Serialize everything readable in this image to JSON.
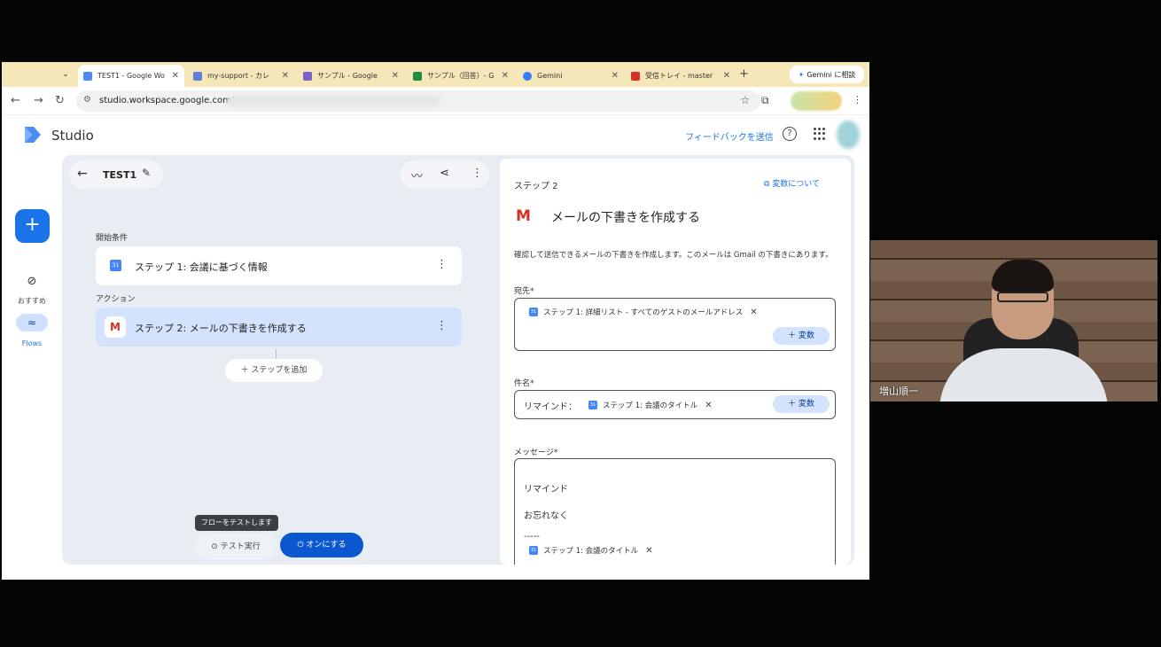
{
  "browser": {
    "tabs": [
      {
        "title": "TEST1 - Google Wo",
        "color": "#4c8bf5",
        "active": true
      },
      {
        "title": "my-support - カレ",
        "color": "#5f7fdb",
        "active": false
      },
      {
        "title": "サンプル - Google",
        "color": "#7b61c9",
        "active": false
      },
      {
        "title": "サンプル（回答）- G",
        "color": "#1e8e3e",
        "active": false
      },
      {
        "title": "Gemini",
        "color": "#3a7bf7",
        "active": false
      },
      {
        "title": "受信トレイ - master",
        "color": "#d93025",
        "active": false
      }
    ],
    "gemini_button": "Gemini に相談",
    "url": "studio.workspace.google.com/"
  },
  "studio": {
    "app_name": "Studio",
    "feedback": "フィードバックを送信"
  },
  "rail": {
    "recommend_label": "おすすめ",
    "flows_label": "Flows"
  },
  "flow": {
    "name": "TEST1",
    "trigger_label": "開始条件",
    "action_label": "アクション",
    "step1": "ステップ 1: 会議に基づく情報",
    "step2": "ステップ 2: メールの下書きを作成する",
    "add_step": "＋ ステップを追加",
    "tooltip": "フローをテストします",
    "test_run": "⊙ テスト実行",
    "turn_on": "⏻ オンにする"
  },
  "panel": {
    "step": "ステップ 2",
    "about_vars": "変数について",
    "title": "メールの下書きを作成する",
    "description": "確認して送信できるメールの下書きを作成します。このメールは Gmail の下書きにあります。",
    "to_label": "宛先*",
    "to_chip": "ステップ 1: 詳細リスト - すべてのゲストのメールアドレス",
    "var_button": "＋ 変数",
    "subject_label": "件名*",
    "subject_prefix": "リマインド：",
    "subject_chip": "ステップ 1: 会議のタイトル",
    "message_label": "メッセージ*",
    "message_line1": "リマインド",
    "message_line2": "お忘れなく",
    "message_line3": "-----",
    "message_chip": "ステップ 1: 会議のタイトル"
  },
  "webcam": {
    "participant": "増山順一"
  }
}
